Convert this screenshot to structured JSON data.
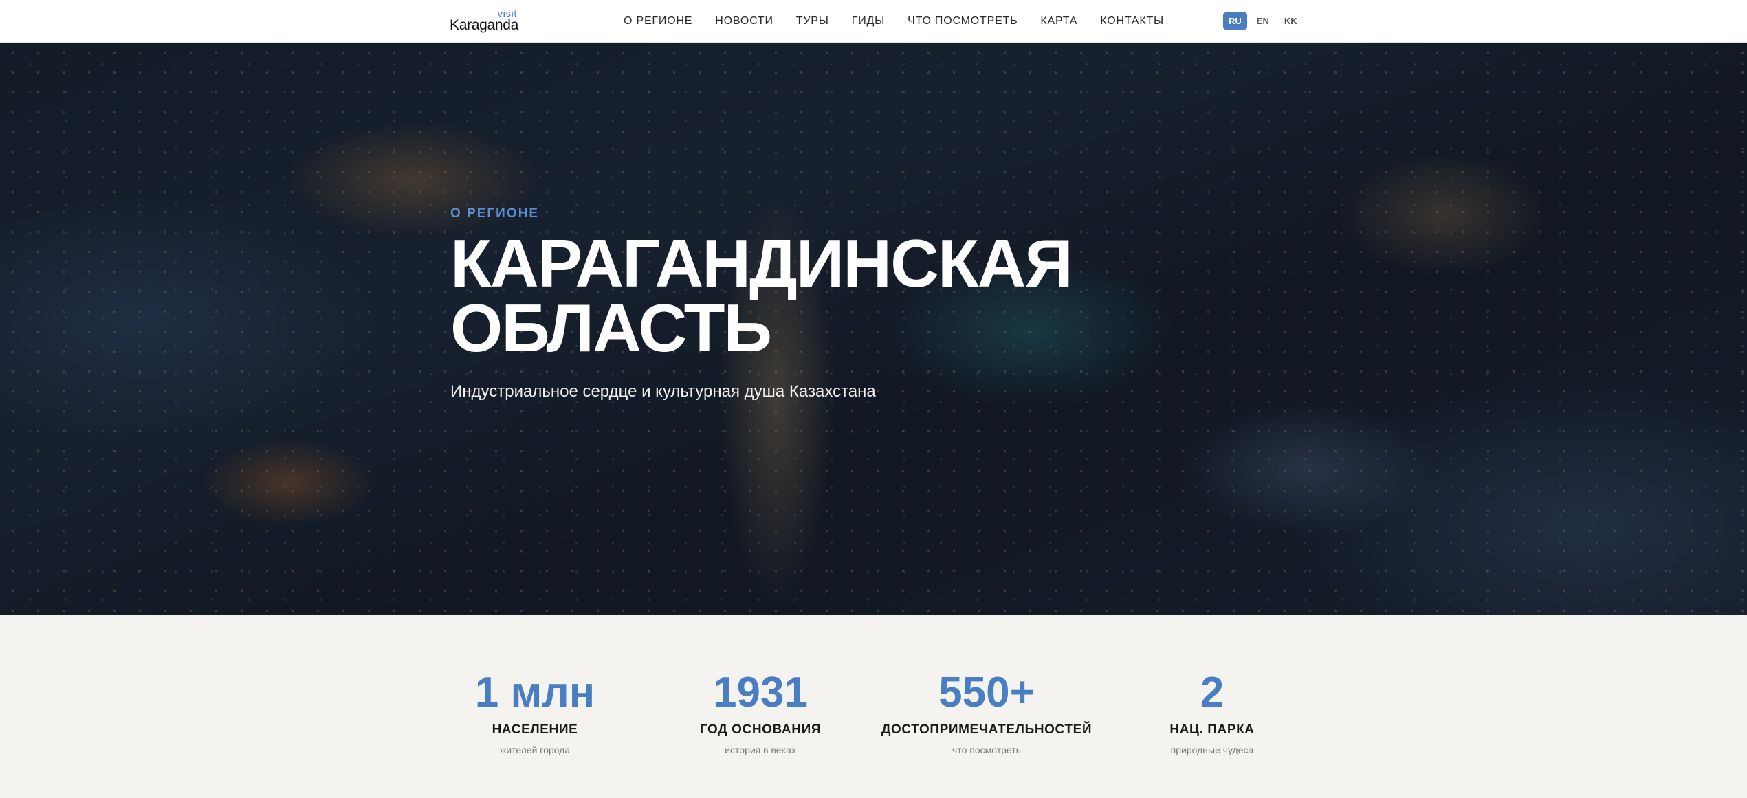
{
  "header": {
    "logo": {
      "visit": "visit",
      "name": "Karaganda"
    },
    "nav": [
      {
        "label": "О РЕГИОНЕ"
      },
      {
        "label": "НОВОСТИ"
      },
      {
        "label": "ТУРЫ"
      },
      {
        "label": "ГИДЫ"
      },
      {
        "label": "ЧТО ПОСМОТРЕТЬ"
      },
      {
        "label": "КАРТА"
      },
      {
        "label": "КОНТАКТЫ"
      }
    ],
    "languages": [
      {
        "code": "RU",
        "active": true
      },
      {
        "code": "EN",
        "active": false
      },
      {
        "code": "KK",
        "active": false
      }
    ]
  },
  "hero": {
    "eyebrow": "О РЕГИОНЕ",
    "title_line1": "КАРАГАНДИНСКАЯ",
    "title_line2": "ОБЛАСТЬ",
    "subtitle": "Индустриальное сердце и культурная душа Казахстана"
  },
  "stats": [
    {
      "value": "1 млн",
      "label": "НАСЕЛЕНИЕ",
      "note": "жителей города"
    },
    {
      "value": "1931",
      "label": "ГОД ОСНОВАНИЯ",
      "note": "история в веках"
    },
    {
      "value": "550+",
      "label": "ДОСТОПРИМЕЧАТЕЛЬНОСТЕЙ",
      "note": "что посмотреть"
    },
    {
      "value": "2",
      "label": "НАЦ. ПАРКА",
      "note": "природные чудеса"
    }
  ],
  "colors": {
    "accent": "#4a7ec2",
    "stats_background": "#f4f3ef",
    "header_background": "#ffffff"
  }
}
